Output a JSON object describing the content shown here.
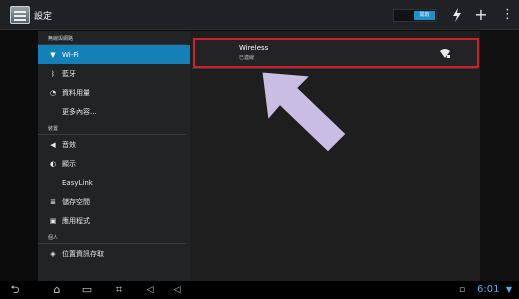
{
  "actionbar": {
    "title": "設定",
    "toggle_label": "開啟",
    "icons": [
      "settings-app-icon",
      "sync-icon",
      "add-icon",
      "overflow-menu-icon"
    ]
  },
  "sidebar": {
    "sections": [
      {
        "header": "無線與網路",
        "items": [
          {
            "label": "Wi-Fi",
            "icon": "wifi-icon",
            "active": true
          },
          {
            "label": "藍牙",
            "icon": "bluetooth-icon"
          },
          {
            "label": "資料用量",
            "icon": "data-usage-icon"
          },
          {
            "label": "更多內容...",
            "icon": ""
          }
        ]
      },
      {
        "header": "裝置",
        "items": [
          {
            "label": "音效",
            "icon": "sound-icon"
          },
          {
            "label": "顯示",
            "icon": "display-icon"
          },
          {
            "label": "EasyLink",
            "icon": ""
          },
          {
            "label": "儲存空間",
            "icon": "storage-icon"
          },
          {
            "label": "應用程式",
            "icon": "apps-icon"
          }
        ]
      },
      {
        "header": "個人",
        "items": [
          {
            "label": "位置資訊存取",
            "icon": "location-icon"
          }
        ]
      }
    ]
  },
  "wifi_list": {
    "networks": [
      {
        "name": "Wireless",
        "status": "已連線",
        "icon": "wifi-signal-icon"
      }
    ]
  },
  "statusbar": {
    "time": "6:01"
  },
  "colors": {
    "accent": "#1480b8",
    "highlight_box": "#d0202a",
    "arrow": "#c9bde4",
    "clock": "#4fb5e6"
  }
}
